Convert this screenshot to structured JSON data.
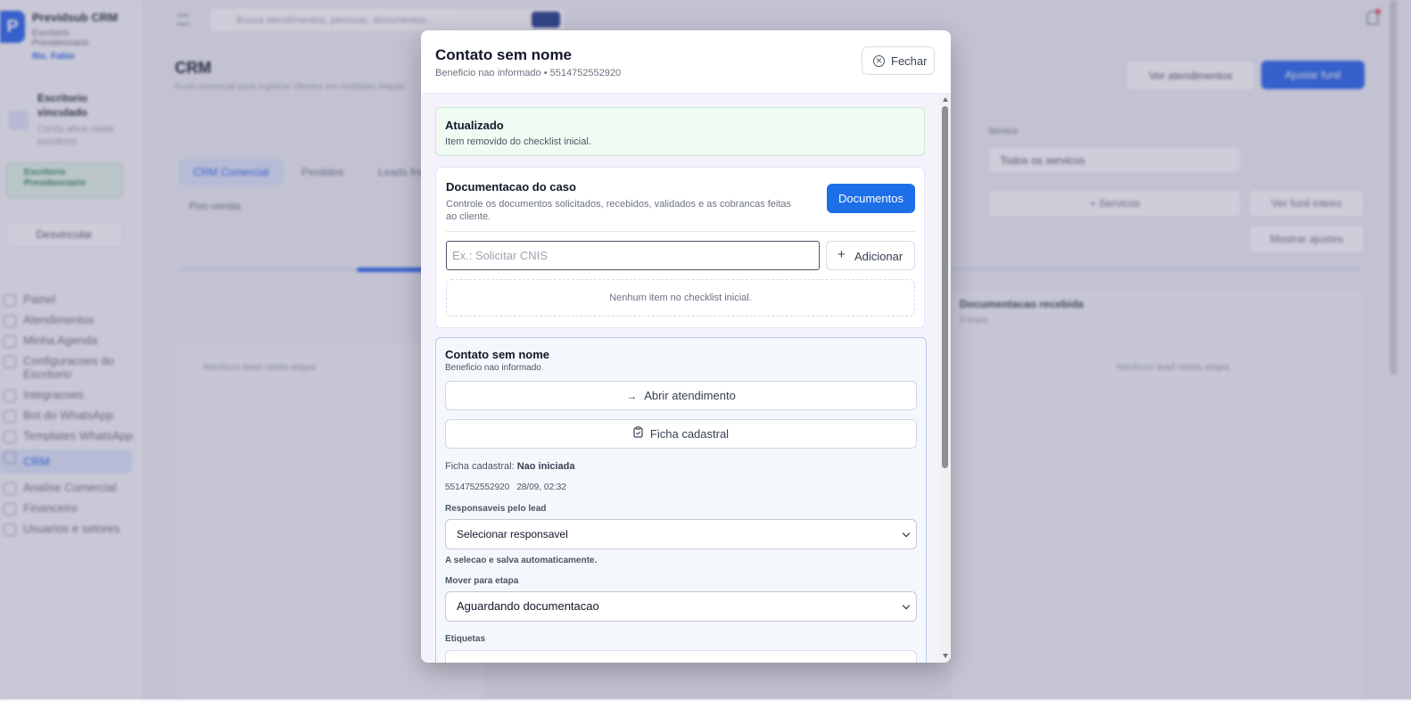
{
  "background": {
    "brand": {
      "logo": "P",
      "name": "Previdsub CRM",
      "subtitle": "Escritorio Previdenciario",
      "user": "Ric. Fabio"
    },
    "office": {
      "title": "Escritorio vinculado",
      "subtitle": "Conta ativa neste escritorio",
      "badge": "Escritorio Previdenciario"
    },
    "logout_label": "Desvincular",
    "nav_items": [
      {
        "label": "Painel"
      },
      {
        "label": "Atendimentos"
      },
      {
        "label": "Minha Agenda"
      },
      {
        "label": "Configuracoes do Escritorio"
      },
      {
        "label": "Integracoes"
      },
      {
        "label": "Bot do WhatsApp"
      },
      {
        "label": "Templates WhatsApp"
      },
      {
        "label": "CRM"
      },
      {
        "label": "Analise Comercial"
      },
      {
        "label": "Financeiro"
      },
      {
        "label": "Usuarios e setores"
      }
    ],
    "search_placeholder": "Busca atendimentos, pessoas, documentos...",
    "page_title": "CRM",
    "page_subtitle": "Funil comercial para registrar clientes em multiplas etapas",
    "view_attendances_label": "Ver atendimentos",
    "adjust_funnel_label": "Ajustar funil",
    "tabs": [
      "CRM Comercial",
      "Perdidos",
      "Leads frios"
    ],
    "funnel_label": "Pos-venda",
    "filter_label": "Servico",
    "filter_value": "Todos os servicos",
    "services_button": "+ Servicos",
    "view_funnel_button": "Ver funil inteiro",
    "show_adjust_button": "Mostrar ajustes",
    "column_title": "Documentacao recebida",
    "column_count": "0 leads",
    "empty_stage_left": "Nenhum lead nesta etapa",
    "empty_stage_right": "Nenhum lead nesta etapa"
  },
  "modal": {
    "title": "Contato sem nome",
    "subtitle": "Beneficio nao informado • 5514752552920",
    "close_label": "Fechar",
    "updated": {
      "title": "Atualizado",
      "message": "Item removido do checklist inicial."
    },
    "docs": {
      "title": "Documentacao do caso",
      "description": "Controle os documentos solicitados, recebidos, validados e as cobrancas feitas ao cliente.",
      "button_label": "Documentos",
      "input_placeholder": "Ex.: Solicitar CNIS",
      "input_value": "",
      "add_label": "Adicionar",
      "empty_message": "Nenhum item no checklist inicial."
    },
    "contact": {
      "title": "Contato sem nome",
      "subtitle": "Beneficio nao informado",
      "open_label": "Abrir atendimento",
      "form_label": "Ficha cadastral",
      "form_status_label": "Ficha cadastral:",
      "form_status_value": "Nao iniciada",
      "phone": "5514752552920",
      "datetime": "28/09, 02:32",
      "responsible_label": "Responsaveis pelo lead",
      "responsible_value": "Selecionar responsavel",
      "auto_save_note": "A selecao e salva automaticamente.",
      "stage_label": "Mover para etapa",
      "stage_value": "Aguardando documentacao",
      "tags_label": "Etiquetas"
    }
  },
  "colors": {
    "primary": "#1d6fe8",
    "success_bg": "#effbf3",
    "contact_card_border": "#b7cce9"
  }
}
